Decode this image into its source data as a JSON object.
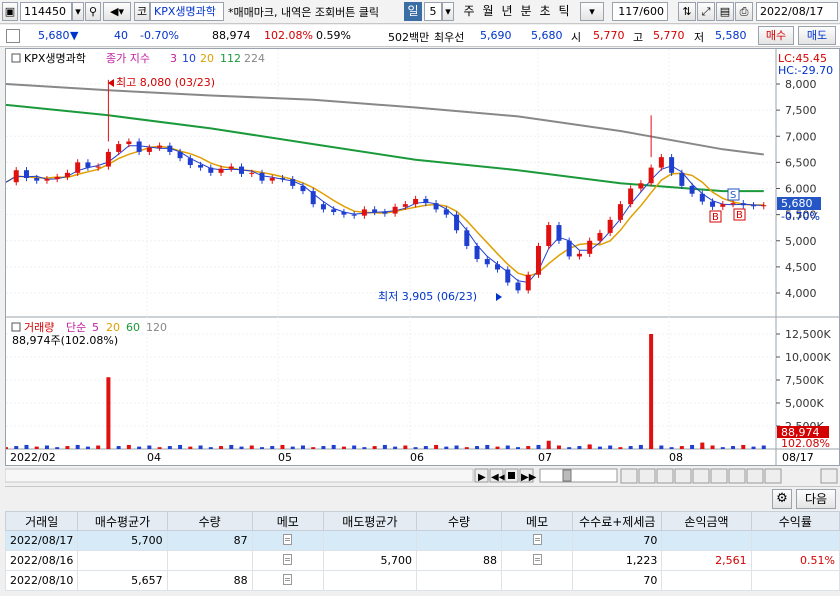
{
  "toolbar": {
    "code": "114450",
    "market": "코",
    "stock_name": "KPX생명과학",
    "notice": "*매매마크, 내역은 조회버튼 클릭",
    "period_selected": "일",
    "period_num": "5",
    "periods": [
      "주",
      "월",
      "년",
      "분",
      "초",
      "틱"
    ],
    "count": "117/600",
    "date": "2022/08/17"
  },
  "quote": {
    "price": "5,680",
    "change": "40",
    "change_pct": "-0.70%",
    "volume": "88,974",
    "vol_ratio": "102.08%",
    "turnover": "0.59%",
    "amount": "502백만",
    "best_label": "최우선",
    "best_ask": "5,690",
    "best_bid": "5,680",
    "open_label": "시",
    "open": "5,770",
    "high_label": "고",
    "high": "5,770",
    "low_label": "저",
    "low": "5,580",
    "buy_btn": "매수",
    "sell_btn": "매도"
  },
  "chart": {
    "price_legend": {
      "name": "KPX생명과학",
      "ma_label": "종가 지수",
      "ma": [
        "3",
        "10",
        "20",
        "112",
        "224"
      ]
    },
    "lc": "LC:45.45",
    "hc": "HC:-29.70",
    "price_axis": [
      "8,000",
      "7,500",
      "7,000",
      "6,500",
      "6,000",
      "5,500",
      "5,000",
      "4,500",
      "4,000"
    ],
    "price_tag": "5,680",
    "pct_tag": "-0.70%",
    "high_annot": "최고 8,080 (03/23)",
    "low_annot": "최저 3,905 (06/23)",
    "vol_legend": {
      "name": "거래량",
      "ma_label": "단순",
      "ma": [
        "5",
        "20",
        "60",
        "120"
      ]
    },
    "vol_value": "88,974주(102.08%)",
    "vol_axis": [
      "12,500K",
      "10,000K",
      "7,500K",
      "5,000K",
      "2,500K"
    ],
    "vol_tag": "88,974",
    "vol_pct_tag": "102.08%",
    "x_labels": [
      "2022/02",
      "04",
      "05",
      "06",
      "07",
      "08",
      "08/17"
    ],
    "markers": [
      "S",
      "B",
      "B"
    ]
  },
  "bottom": {
    "next_btn": "다음"
  },
  "table": {
    "headers": [
      "거래일",
      "매수평균가",
      "수량",
      "메모",
      "매도평균가",
      "수량",
      "메모",
      "수수료+제세금",
      "손익금액",
      "수익률"
    ],
    "rows": [
      {
        "date": "2022/08/17",
        "buy_avg": "5,700",
        "buy_qty": "87",
        "sell_avg": "",
        "sell_qty": "",
        "fee": "70",
        "pnl": "",
        "ret": ""
      },
      {
        "date": "2022/08/16",
        "buy_avg": "",
        "buy_qty": "",
        "sell_avg": "5,700",
        "sell_qty": "88",
        "fee": "1,223",
        "pnl": "2,561",
        "ret": "0.51%"
      },
      {
        "date": "2022/08/10",
        "buy_avg": "5,657",
        "buy_qty": "88",
        "sell_avg": "",
        "sell_qty": "",
        "fee": "70",
        "pnl": "",
        "ret": ""
      }
    ]
  },
  "chart_data": {
    "type": "candlestick",
    "price_series": [
      {
        "name": "price",
        "points": [
          [
            0,
            6120
          ],
          [
            4,
            6350
          ],
          [
            8,
            6200
          ],
          [
            12,
            6150
          ],
          [
            16,
            6180
          ],
          [
            20,
            6220
          ],
          [
            24,
            6300
          ],
          [
            28,
            6500
          ],
          [
            32,
            6400
          ],
          [
            36,
            6420
          ],
          [
            40,
            6700
          ],
          [
            44,
            6850
          ],
          [
            48,
            6900
          ],
          [
            52,
            6700
          ],
          [
            56,
            6780
          ],
          [
            60,
            6820
          ],
          [
            64,
            6700
          ],
          [
            68,
            6580
          ],
          [
            72,
            6450
          ],
          [
            76,
            6400
          ],
          [
            80,
            6300
          ],
          [
            84,
            6380
          ],
          [
            88,
            6420
          ],
          [
            92,
            6280
          ],
          [
            96,
            6300
          ],
          [
            100,
            6150
          ],
          [
            104,
            6200
          ],
          [
            108,
            6180
          ],
          [
            112,
            6050
          ],
          [
            116,
            5950
          ],
          [
            120,
            5700
          ],
          [
            124,
            5600
          ],
          [
            128,
            5550
          ],
          [
            132,
            5500
          ],
          [
            136,
            5480
          ],
          [
            140,
            5600
          ],
          [
            144,
            5550
          ],
          [
            148,
            5520
          ],
          [
            152,
            5650
          ],
          [
            156,
            5700
          ],
          [
            160,
            5800
          ],
          [
            164,
            5720
          ],
          [
            168,
            5600
          ],
          [
            172,
            5500
          ],
          [
            176,
            5200
          ],
          [
            180,
            4900
          ],
          [
            184,
            4650
          ],
          [
            188,
            4550
          ],
          [
            192,
            4450
          ],
          [
            196,
            4200
          ],
          [
            200,
            4050
          ],
          [
            204,
            4350
          ],
          [
            208,
            4900
          ],
          [
            212,
            5300
          ],
          [
            216,
            5000
          ],
          [
            220,
            4700
          ],
          [
            224,
            4750
          ],
          [
            228,
            5000
          ],
          [
            232,
            5150
          ],
          [
            236,
            5400
          ],
          [
            240,
            5700
          ],
          [
            244,
            6000
          ],
          [
            248,
            6100
          ],
          [
            252,
            6400
          ],
          [
            256,
            6600
          ],
          [
            260,
            6300
          ],
          [
            264,
            6050
          ],
          [
            268,
            5900
          ],
          [
            272,
            5750
          ],
          [
            276,
            5650
          ],
          [
            280,
            5700
          ],
          [
            284,
            5720
          ],
          [
            288,
            5680
          ],
          [
            292,
            5660
          ],
          [
            296,
            5680
          ]
        ]
      },
      {
        "name": "224",
        "points": [
          [
            0,
            8000
          ],
          [
            40,
            7880
          ],
          [
            80,
            7780
          ],
          [
            120,
            7700
          ],
          [
            160,
            7550
          ],
          [
            200,
            7380
          ],
          [
            240,
            7100
          ],
          [
            280,
            6750
          ],
          [
            296,
            6650
          ]
        ]
      },
      {
        "name": "112",
        "points": [
          [
            0,
            7600
          ],
          [
            40,
            7400
          ],
          [
            80,
            7150
          ],
          [
            120,
            6850
          ],
          [
            160,
            6550
          ],
          [
            200,
            6350
          ],
          [
            240,
            6100
          ],
          [
            280,
            5950
          ],
          [
            296,
            5950
          ]
        ]
      }
    ],
    "volume_max": 12500,
    "volume_spikes": [
      [
        40,
        7800
      ],
      [
        212,
        900
      ],
      [
        228,
        500
      ],
      [
        252,
        12500
      ],
      [
        272,
        700
      ]
    ]
  }
}
